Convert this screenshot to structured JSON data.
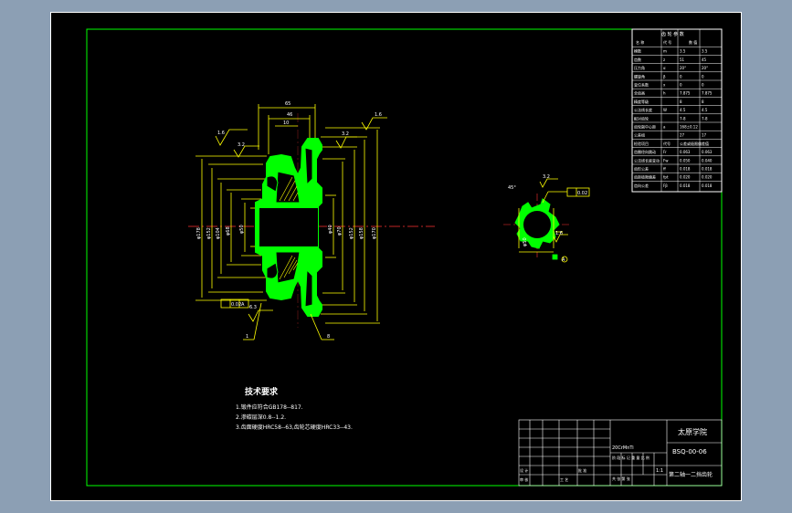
{
  "drawing": {
    "colors": {
      "background": "#000000",
      "frame": "#00ff00",
      "geometry": "#ffff00",
      "part_fill": "#00ff00",
      "dimension": "#ffffff",
      "centerline": "#ff3333",
      "window_backdrop": "#8c9fb4"
    }
  },
  "tech_req": {
    "title": "技术要求",
    "lines": [
      "1.锻件应符合GB178--817.",
      "2.渗碳层深0.8--1.2.",
      "3.齿面硬度HRC58--63,齿轮芯硬度HRC33--43."
    ]
  },
  "title_block": {
    "school": "太原学院",
    "drawing_no": "BSQ-00-06",
    "part_name": "第二轴一二挡齿轮",
    "scale_row": "阶 段 标 记   重 量   比 例",
    "scale_value": "1:1",
    "sheet_row": "共   张   第   张",
    "designer_label": "设 计",
    "checker_label": "审 核",
    "process_label": "工 艺",
    "approve_label": "批 准",
    "material": "20CrMnTi"
  },
  "param_table": {
    "header": "齿 轮 参 数",
    "col_headers": [
      "名 称",
      "代 号",
      "数 值"
    ],
    "rows": [
      [
        "模数",
        "m",
        "3.5",
        "3.5"
      ],
      [
        "齿数",
        "z",
        "51",
        "45"
      ],
      [
        "压力角",
        "α",
        "20°",
        "20°"
      ],
      [
        "螺旋角",
        "β",
        "0",
        "0"
      ],
      [
        "变位系数",
        "x",
        "0",
        "0"
      ],
      [
        "全齿高",
        "h",
        "7.875",
        "7.875"
      ],
      [
        "精度等级",
        "",
        "8",
        "8"
      ],
      [
        "公法线长度",
        "W",
        "4.5",
        "4.5"
      ],
      [
        "配对齿轮",
        "",
        "7-8",
        "7-8"
      ],
      [
        "齿轮副中心距",
        "a",
        "168±0.12",
        ""
      ],
      [
        "公差组",
        "",
        "27",
        "17"
      ],
      [
        "检验项目",
        "代号",
        "公差或极限偏差值",
        ""
      ],
      [
        "齿圈径向跳动",
        "Fr",
        "0.063",
        "0.063"
      ],
      [
        "公法线长度变动",
        "Fw",
        "0.050",
        "0.040"
      ],
      [
        "齿形公差",
        "ff",
        "0.018",
        "0.018"
      ],
      [
        "齿距极限偏差",
        "fpt",
        "0.020",
        "0.020"
      ],
      [
        "齿向公差",
        "Fβ",
        "0.018",
        "0.018"
      ]
    ],
    "group_labels": [
      "I",
      "II",
      "III"
    ]
  },
  "dims": {
    "top_overall": "65",
    "top_inner": "46",
    "top_small": "10",
    "rough_left": "1.6",
    "rough_left2": "3.2",
    "rough_right": "1.6",
    "rough_mid": "3.2",
    "left_diams": [
      "φ178",
      "φ152",
      "φ104",
      "φ68",
      "φ50"
    ],
    "right_diams": [
      "φ170",
      "φ158",
      "φ152",
      "φ70",
      "φ40"
    ],
    "tol_box_bottom": "0.02",
    "tol_box_bottom2": "A",
    "rough_bottom": "6.3",
    "callouts": [
      "1",
      "8"
    ],
    "spline_tol": "0.02",
    "spline_label": "A",
    "spline_rough": "3.2",
    "spline_rough2": "1.6",
    "spline_dim": "φ50",
    "spline_angle": "45°"
  }
}
